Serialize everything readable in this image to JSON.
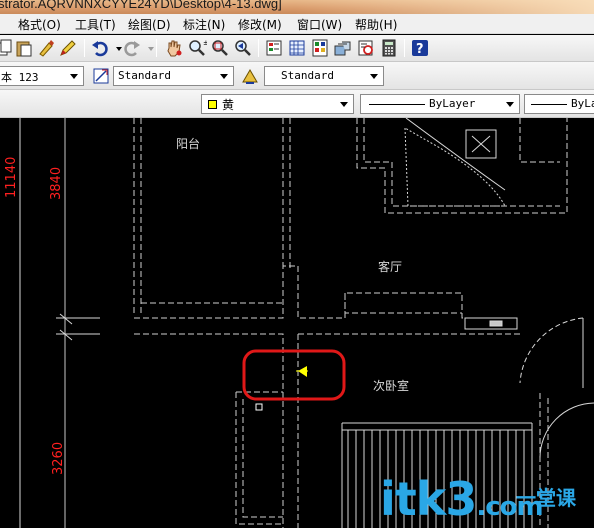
{
  "window": {
    "title": "strator.AQRVNNXCYYE24YD\\Desktop\\4-13.dwg]"
  },
  "menubar": {
    "items": [
      "格式(O)",
      "工具(T)",
      "绘图(D)",
      "标注(N)",
      "修改(M)",
      "窗口(W)",
      "帮助(H)"
    ]
  },
  "toolbar_styles": {
    "text_style": "本 123",
    "dim_style": "Standard",
    "table_style": "Standard"
  },
  "toolbar_properties": {
    "color": "黄",
    "color_hex": "#ffff00",
    "linetype": "ByLayer",
    "lineweight": "ByLa"
  },
  "drawing": {
    "room_labels": {
      "balcony": "阳台",
      "living_room": "客厅",
      "bedroom": "次卧室"
    },
    "dimensions": {
      "total": "11140",
      "upper": "3840",
      "lower": "3260"
    },
    "highlight_color": "#e01818",
    "dim_color": "#ff2020"
  },
  "watermark": {
    "brand": "itk3",
    "suffix": ".com",
    "side": "一堂课"
  }
}
